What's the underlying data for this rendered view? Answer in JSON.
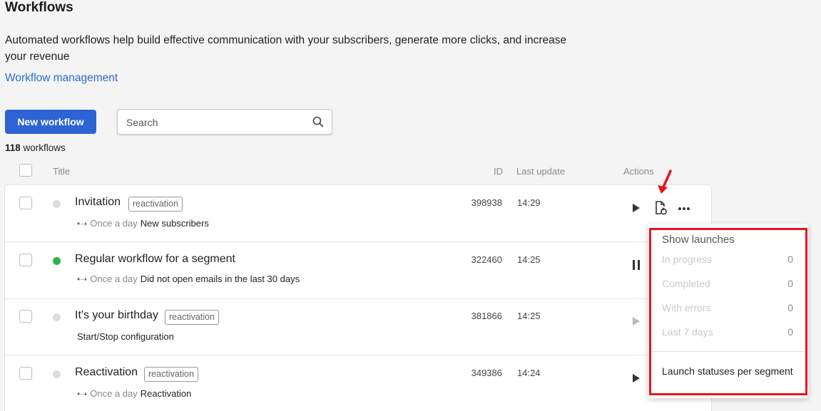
{
  "header": {
    "title": "Workflows",
    "description": "Automated workflows help build effective communication with your subscribers, generate more clicks, and increase your revenue",
    "management_link": "Workflow management"
  },
  "toolbar": {
    "new_button": "New workflow",
    "search_placeholder": "Search"
  },
  "summary": {
    "count": "118",
    "count_label": "workflows"
  },
  "columns": {
    "title": "Title",
    "id": "ID",
    "last_update": "Last update",
    "actions": "Actions"
  },
  "rows": [
    {
      "title": "Invitation",
      "tag": "reactivation",
      "status": "inactive",
      "arrow": "•➝",
      "frequency": "Once a day",
      "segment": "New subscribers",
      "note": "",
      "id": "398938",
      "time": "14:29",
      "action": "play"
    },
    {
      "title": "Regular workflow for a segment",
      "tag": "",
      "status": "active",
      "arrow": "•➝",
      "frequency": "Once a day",
      "segment": "Did not open emails in the last 30 days",
      "note": "",
      "id": "322460",
      "time": "14:25",
      "action": "pause"
    },
    {
      "title": "It's your birthday",
      "tag": "reactivation",
      "status": "inactive",
      "arrow": "",
      "frequency": "",
      "segment": "",
      "note": "Start/Stop configuration",
      "id": "381866",
      "time": "14:25",
      "action": "play-disabled"
    },
    {
      "title": "Reactivation",
      "tag": "reactivation",
      "status": "inactive",
      "arrow": "•➝",
      "frequency": "Once a day",
      "segment": "Reactivation",
      "note": "",
      "id": "349386",
      "time": "14:24",
      "action": "play"
    }
  ],
  "launches_popup": {
    "title": "Show launches",
    "stats": [
      {
        "label": "In progress",
        "value": "0"
      },
      {
        "label": "Completed",
        "value": "0"
      },
      {
        "label": "With errors",
        "value": "0"
      },
      {
        "label": "Last 7 days",
        "value": "0"
      }
    ],
    "link": "Launch statuses per segment"
  },
  "colors": {
    "primary": "#2c64d6",
    "link": "#2a6ec9",
    "active_status": "#2fb24c",
    "highlight": "#e8141b"
  },
  "icons": [
    "search-icon",
    "play-icon",
    "pause-icon",
    "show-launches-icon",
    "more-icon",
    "annotation-arrow"
  ]
}
